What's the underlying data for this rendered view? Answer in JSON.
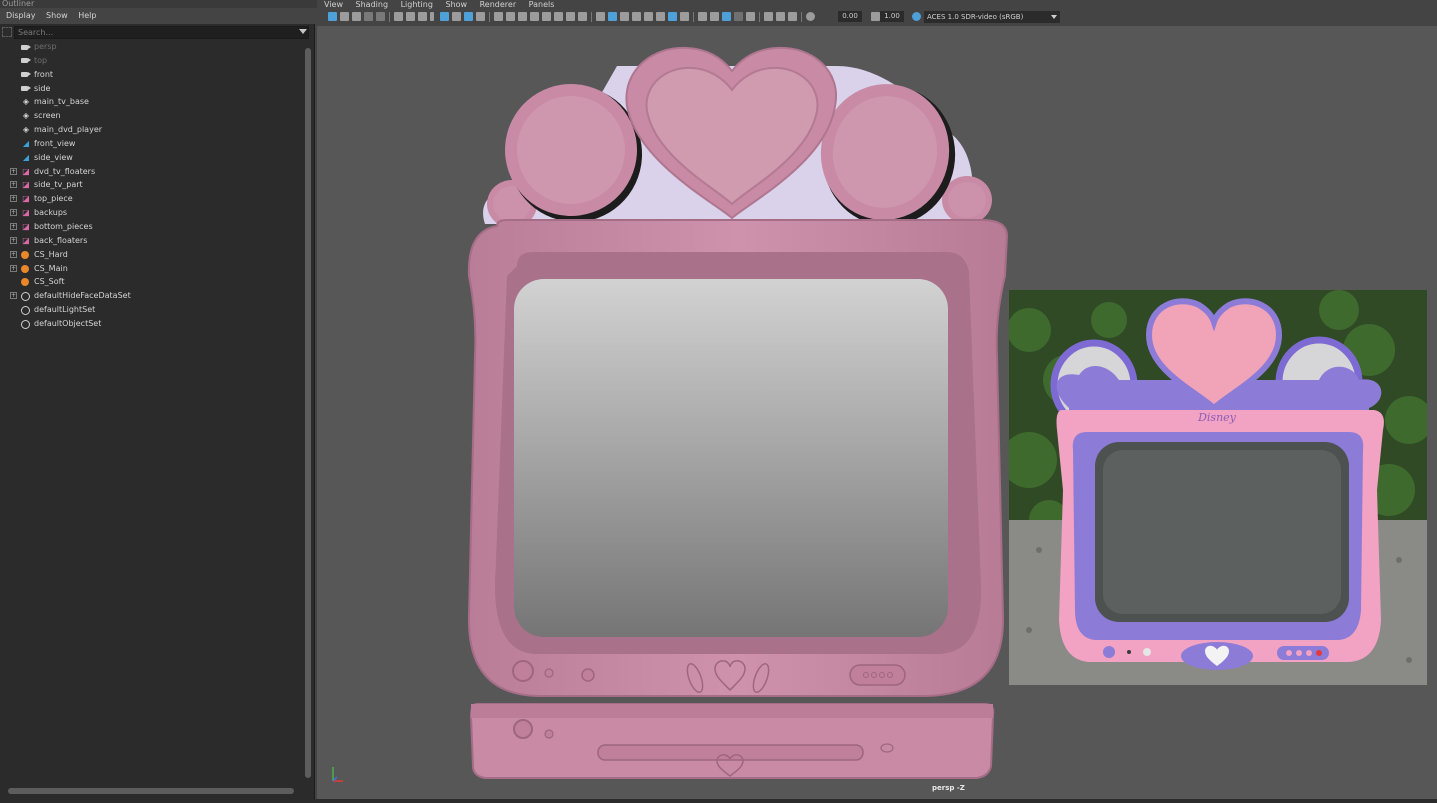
{
  "outliner": {
    "title": "Outliner",
    "menu": [
      "Display",
      "Show",
      "Help"
    ],
    "search_placeholder": "Search...",
    "items": [
      {
        "label": "persp",
        "type": "camera",
        "dim": true
      },
      {
        "label": "top",
        "type": "camera",
        "dim": true
      },
      {
        "label": "front",
        "type": "camera",
        "dim": false
      },
      {
        "label": "side",
        "type": "camera",
        "dim": false
      },
      {
        "label": "main_tv_base",
        "type": "mesh",
        "dim": false
      },
      {
        "label": "screen",
        "type": "mesh",
        "dim": false
      },
      {
        "label": "main_dvd_player",
        "type": "mesh",
        "dim": false
      },
      {
        "label": "front_view",
        "type": "image-plane",
        "dim": false
      },
      {
        "label": "side_view",
        "type": "image-plane",
        "dim": false
      },
      {
        "label": "dvd_tv_floaters",
        "type": "group",
        "expandable": true
      },
      {
        "label": "side_tv_part",
        "type": "group",
        "expandable": true
      },
      {
        "label": "top_piece",
        "type": "group",
        "expandable": true
      },
      {
        "label": "backups",
        "type": "group",
        "expandable": true
      },
      {
        "label": "bottom_pieces",
        "type": "group",
        "expandable": true
      },
      {
        "label": "back_floaters",
        "type": "group",
        "expandable": true
      },
      {
        "label": "CS_Hard",
        "type": "character-set",
        "expandable": true
      },
      {
        "label": "CS_Main",
        "type": "character-set",
        "expandable": true
      },
      {
        "label": "CS_Soft",
        "type": "character-set",
        "expandable": false
      },
      {
        "label": "defaultHideFaceDataSet",
        "type": "set",
        "expandable": true
      },
      {
        "label": "defaultLightSet",
        "type": "set",
        "expandable": false
      },
      {
        "label": "defaultObjectSet",
        "type": "set",
        "expandable": false
      }
    ]
  },
  "viewport": {
    "menu": [
      "View",
      "Shading",
      "Lighting",
      "Show",
      "Renderer",
      "Panels"
    ],
    "exposure": "0.00",
    "gamma": "1.00",
    "color_space": "ACES 1.0 SDR-video (sRGB)",
    "camera_label": "persp -Z",
    "reference_logo": "Disney"
  },
  "colors": {
    "tv_pink": "#c98aa6",
    "ref_pink": "#f2a2c2",
    "ref_purple": "#8d7bd8",
    "accent_blue": "#4da0d8"
  }
}
